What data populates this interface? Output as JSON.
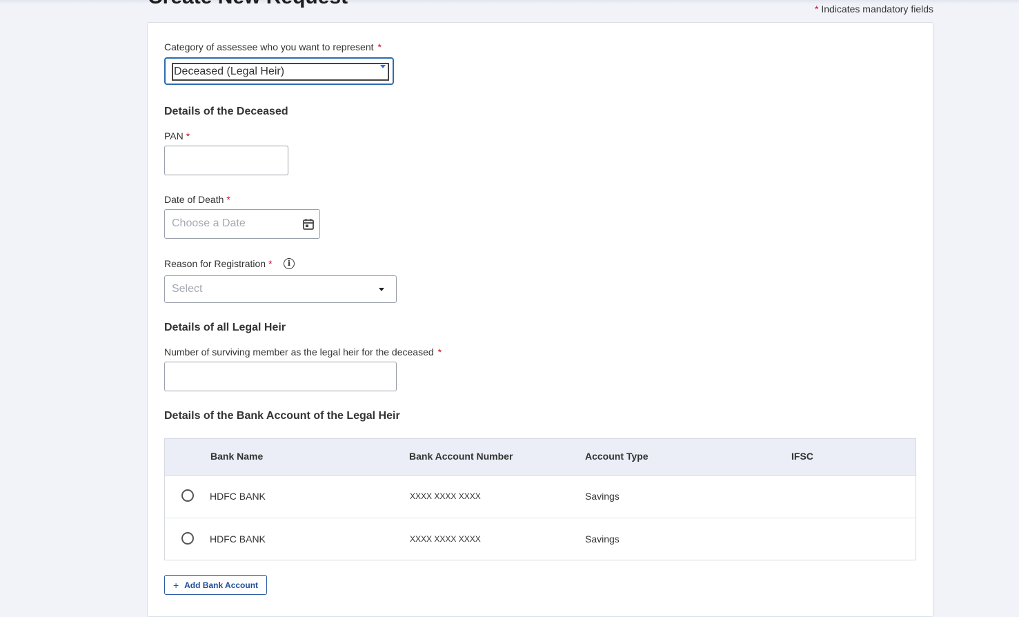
{
  "page": {
    "title": "Create New Request",
    "mandatory_star": "*",
    "mandatory_note": "Indicates mandatory fields"
  },
  "form": {
    "category": {
      "label": "Category of assessee who you want to represent",
      "required": "*",
      "value": "Deceased (Legal Heir)"
    },
    "deceased_section_title": "Details of the Deceased",
    "pan": {
      "label": "PAN",
      "required": "*",
      "value": ""
    },
    "date_of_death": {
      "label": "Date of Death",
      "required": "*",
      "placeholder": "Choose a Date"
    },
    "reason": {
      "label": "Reason for Registration",
      "required": "*",
      "placeholder": "Select",
      "info_icon": "info-icon"
    },
    "legal_heir_section_title": "Details of all Legal Heir",
    "surviving_members": {
      "label": "Number of surviving member as the legal heir for the deceased",
      "required": "*",
      "value": ""
    },
    "bank_section_title": "Details of the Bank Account of the Legal Heir"
  },
  "bank_table": {
    "columns": [
      "Bank Name",
      "Bank Account Number",
      "Account Type",
      "IFSC"
    ],
    "rows": [
      {
        "bank_name": "HDFC BANK",
        "account_number": "XXXX XXXX XXXX",
        "account_type": "Savings",
        "ifsc": ""
      },
      {
        "bank_name": "HDFC BANK",
        "account_number": "XXXX XXXX XXXX",
        "account_type": "Savings",
        "ifsc": ""
      }
    ]
  },
  "add_bank_button": {
    "icon": "+",
    "label": "Add Bank Account"
  },
  "colors": {
    "accent": "#2b6cb0",
    "required": "#c8102e",
    "table_header": "#ebedf7"
  }
}
